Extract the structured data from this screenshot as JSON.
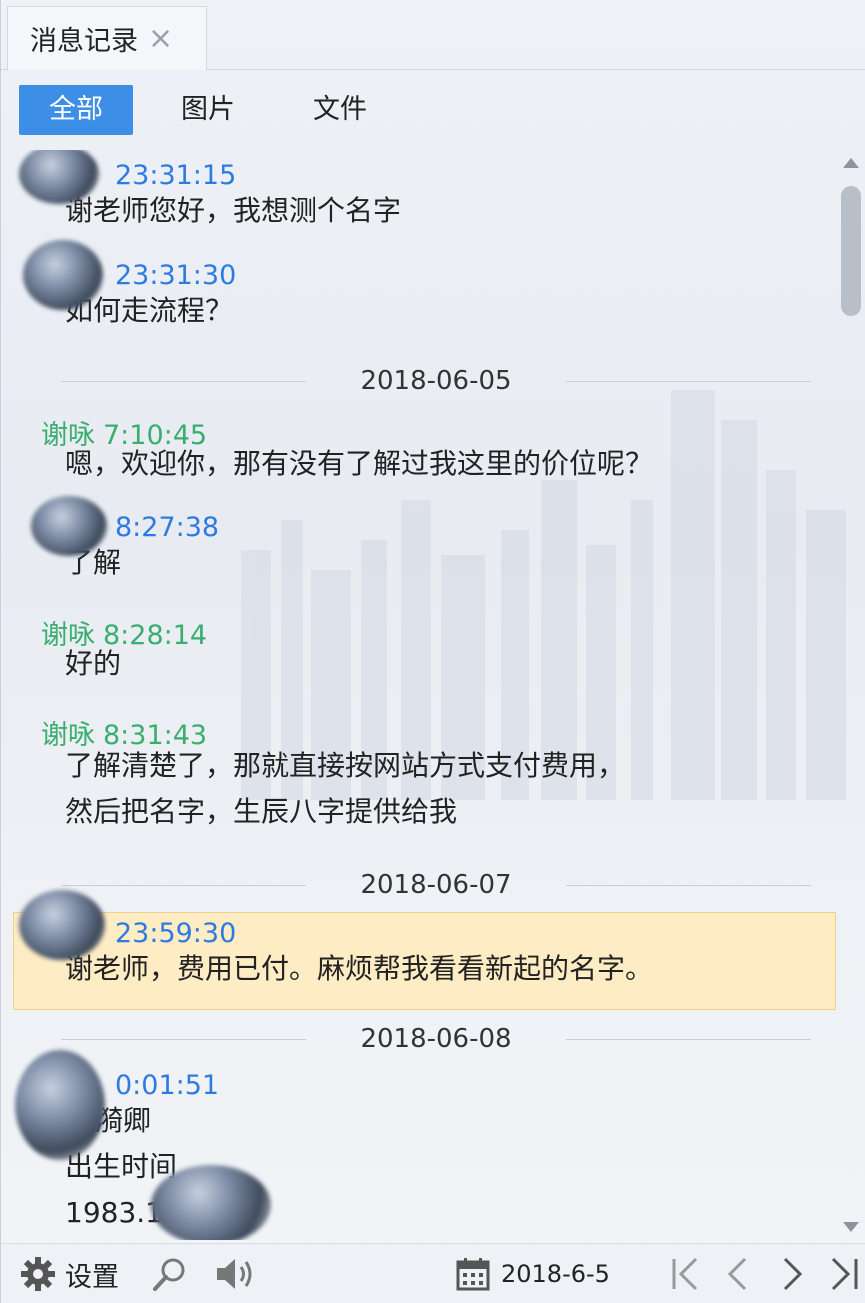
{
  "tab": {
    "title": "消息记录",
    "close_glyph": "×"
  },
  "filters": [
    {
      "label": "全部",
      "active": true
    },
    {
      "label": "图片",
      "active": false
    },
    {
      "label": "文件",
      "active": false
    }
  ],
  "messages": [
    {
      "name": "",
      "time": "23:31:15",
      "color": "blue",
      "lines": [
        "谢老师您好，我想测个名字"
      ]
    },
    {
      "name": "",
      "time": "23:31:30",
      "color": "blue",
      "lines": [
        "如何走流程？"
      ]
    },
    {
      "date_separator": "2018-06-05"
    },
    {
      "name": "谢咏",
      "time": "7:10:45",
      "color": "green",
      "lines": [
        "嗯，欢迎你，那有没有了解过我这里的价位呢？"
      ]
    },
    {
      "name": "",
      "time": "8:27:38",
      "color": "blue",
      "lines": [
        "了解"
      ]
    },
    {
      "name": "谢咏",
      "time": "8:28:14",
      "color": "green",
      "lines": [
        "好的"
      ]
    },
    {
      "name": "谢咏",
      "time": "8:31:43",
      "color": "green",
      "lines": [
        "了解清楚了，那就直接按网站方式支付费用，",
        "然后把名字，生辰八字提供给我"
      ]
    },
    {
      "date_separator": "2018-06-07"
    },
    {
      "name": "",
      "time": "23:59:30",
      "color": "blue",
      "highlighted": true,
      "lines": [
        "谢老师，费用已付。麻烦帮我看看新起的名字。"
      ]
    },
    {
      "date_separator": "2018-06-08"
    },
    {
      "name": "",
      "time": "0:01:51",
      "color": "blue",
      "lines": [
        "漪卿",
        "出生时间",
        "1983.1"
      ]
    }
  ],
  "footer": {
    "settings_label": "设置",
    "date_value": "2018-6-5",
    "icons": [
      "gear-icon",
      "search-icon",
      "speaker-icon",
      "calendar-icon",
      "first-page-icon",
      "prev-page-icon",
      "next-page-icon",
      "last-page-icon"
    ]
  },
  "colors": {
    "accent": "#3d8ee6",
    "peer_name": "#2d7be0",
    "self_name": "#3aae6e",
    "highlight": "#fdecc4"
  }
}
